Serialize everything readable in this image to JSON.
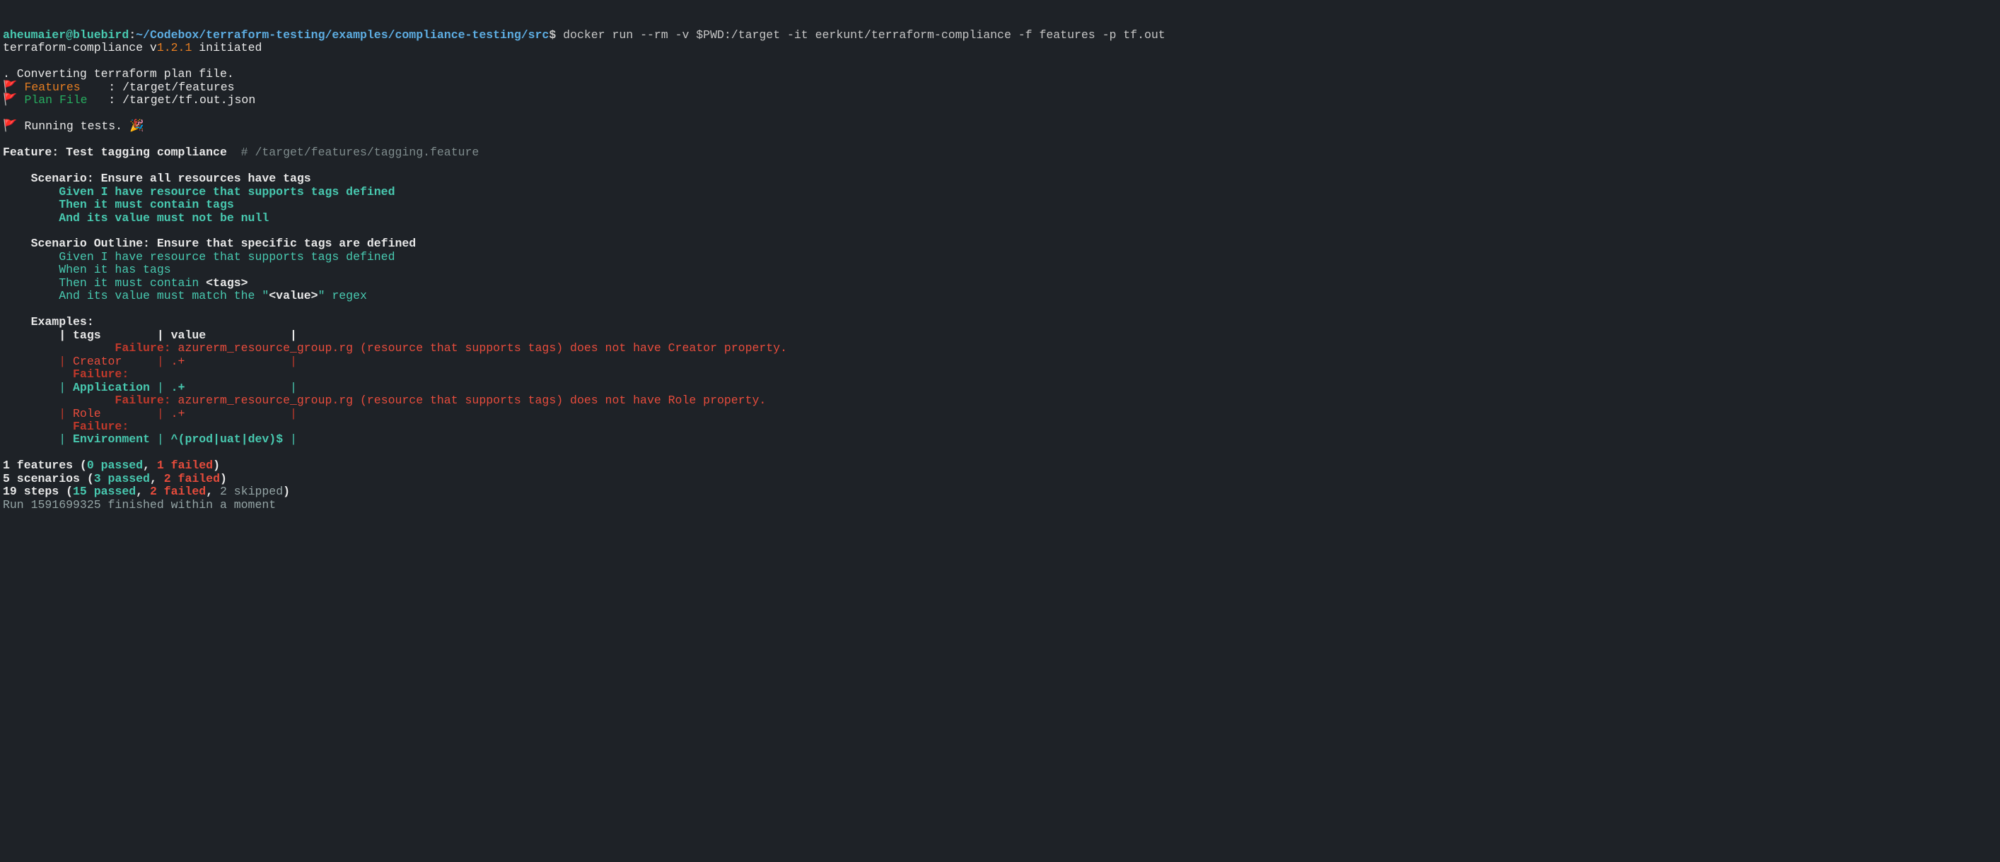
{
  "prompt": {
    "user": "aheumaier@bluebird",
    "sep1": ":",
    "path": "~/Codebox/terraform-testing/examples/compliance-testing/src",
    "dollar": "$",
    "command": " docker run --rm -v $PWD:/target -it eerkunt/terraform-compliance -f features -p tf.out"
  },
  "initiated": {
    "prefix": "terraform-compliance v",
    "version": "1.2.1",
    "suffix": " initiated"
  },
  "converting": ". Converting terraform plan file.",
  "features_line": {
    "flag": "🚩",
    "label": "Features",
    "value": " : /target/features"
  },
  "plan_line": {
    "flag": "🚩",
    "label": "Plan File",
    "value": " : /target/tf.out.json"
  },
  "running": {
    "flag": "🚩",
    "text": " Running tests. ",
    "emoji": "🎉"
  },
  "feature": {
    "title": "Feature: Test tagging compliance",
    "hash": "  # ",
    "file": "/target/features/tagging.feature"
  },
  "scenario1": {
    "title": "    Scenario: Ensure all resources have tags",
    "given": "        Given I have resource that supports tags defined",
    "then": "        Then it must contain tags",
    "and": "        And its value must not be null"
  },
  "scenario2": {
    "title": "    Scenario Outline: Ensure that specific tags are defined",
    "given": "        Given I have resource that supports tags defined",
    "when": "        When it has tags",
    "then1": "        Then it must contain ",
    "tags_tag": "<tags>",
    "and1": "        And its value must match the \"",
    "value_tag": "<value>",
    "and2": "\" regex"
  },
  "examples": {
    "title": "    Examples:",
    "header": "        | tags        | value            |",
    "fail1_prefix": "                Failure: ",
    "fail1_msg": "azurerm_resource_group.rg (resource that supports tags) does not have Creator property.",
    "row1_p1": "        | ",
    "row1_tag": "Creator",
    "row1_p2": "     | ",
    "row1_val": ".+",
    "row1_p3": "               |",
    "fail_short": "          Failure: ",
    "row2_p1": "        | ",
    "row2_tag": "Application",
    "row2_p2": " | ",
    "row2_val": ".+",
    "row2_p3": "               |",
    "fail3_prefix": "                Failure: ",
    "fail3_msg": "azurerm_resource_group.rg (resource that supports tags) does not have Role property.",
    "row3_p1": "        | ",
    "row3_tag": "Role",
    "row3_p2": "        | ",
    "row3_val": ".+",
    "row3_p3": "               |",
    "row4_p1": "        | ",
    "row4_tag": "Environment",
    "row4_p2": " | ",
    "row4_val": "^(prod|uat|dev)$",
    "row4_p3": " |"
  },
  "summary": {
    "features_pre": "1 features (",
    "features_passed": "0 passed",
    "features_mid": ", ",
    "features_failed": "1 failed",
    "features_post": ")",
    "scenarios_pre": "5 scenarios (",
    "scenarios_passed": "3 passed",
    "scenarios_mid": ", ",
    "scenarios_failed": "2 failed",
    "scenarios_post": ")",
    "steps_pre": "19 steps (",
    "steps_passed": "15 passed",
    "steps_mid1": ", ",
    "steps_failed": "2 failed",
    "steps_mid2": ", ",
    "steps_skipped": "2 skipped",
    "steps_post": ")",
    "run": "Run 1591699325 finished within a moment"
  }
}
